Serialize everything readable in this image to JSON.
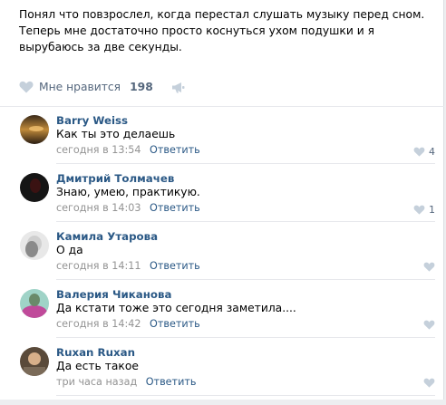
{
  "post": {
    "text": "Понял что повзрослел, когда перестал слушать музыку перед сном. Теперь мне достаточно просто коснуться ухом подушки и я вырубаюсь за две секунды.",
    "like_label": "Мне нравится",
    "like_count": "198"
  },
  "comments": [
    {
      "author": "Barry Weiss",
      "text": "Как ты это делаешь",
      "time": "сегодня в 13:54",
      "reply": "Ответить",
      "likes": "4"
    },
    {
      "author": "Дмитрий Толмачев",
      "text": "Знаю, умею, практикую.",
      "time": "сегодня в 14:03",
      "reply": "Ответить",
      "likes": "1"
    },
    {
      "author": "Камила Утарова",
      "text": "О да",
      "time": "сегодня в 14:11",
      "reply": "Ответить",
      "likes": ""
    },
    {
      "author": "Валерия Чиканова",
      "text": "Да кстати тоже это сегодня заметила....",
      "time": "сегодня в 14:42",
      "reply": "Ответить",
      "likes": ""
    },
    {
      "author": "Ruxan Ruxan",
      "text": "Да есть такое",
      "time": "три часа назад",
      "reply": "Ответить",
      "likes": ""
    }
  ],
  "colors": {
    "link": "#2a5885",
    "meta": "#939393",
    "action": "#55677d",
    "heart": "#c5d0db"
  },
  "icons": {
    "like": "heart-icon",
    "share": "megaphone-icon"
  }
}
